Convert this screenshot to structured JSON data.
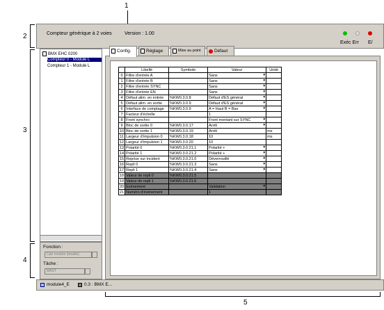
{
  "callouts": {
    "c1": "1",
    "c2": "2",
    "c3": "3",
    "c4": "4",
    "c5": "5"
  },
  "header": {
    "title": "Compteur générique à 2 voies",
    "version": "Version : 1.00",
    "run_err": "Exéc Err",
    "io": "E/",
    "led_colors": {
      "run": "#00c000",
      "err": "#e0e0e0",
      "io": "#e00000"
    }
  },
  "tree": {
    "root": "BMX EHC 0200",
    "items": [
      "Compteur 0 - Module L",
      "Compteur 1 - Module L"
    ]
  },
  "function_label": "Fonction :",
  "function_value": "Cptr module (double)",
  "task_label": "Tâche :",
  "task_value": "MAST",
  "tabs": [
    "Config.",
    "Réglage",
    "Mise au point",
    "Défaut"
  ],
  "table": {
    "headers": [
      "",
      "Libellé",
      "Symbole",
      "Valeur",
      "Unité"
    ],
    "rows": [
      [
        "0",
        "Filtre d'entrée A",
        "",
        "Sans",
        ""
      ],
      [
        "1",
        "Filtre d'entrée B",
        "",
        "Sans",
        ""
      ],
      [
        "2",
        "Filtre d'entrée SYNC",
        "",
        "Sans",
        ""
      ],
      [
        "3",
        "Filtre d'entrée EN",
        "",
        "Sans",
        ""
      ],
      [
        "4",
        "Défaut alim. en entrée",
        "%KW0.3.0.8",
        "Défaut d'ES général",
        ""
      ],
      [
        "5",
        "Défaut alim. en sortie",
        "%KW0.3.0.9",
        "Défaut d'ES général",
        ""
      ],
      [
        "6",
        "Interface de comptage",
        "%KW0.3.0.9",
        "A = Haut B = Bas",
        ""
      ],
      [
        "7",
        "Facteur d'échelle",
        "",
        "1",
        ""
      ],
      [
        "8",
        "Front synchro",
        "",
        "Front montant sur SYNC",
        ""
      ],
      [
        "9",
        "Bloc de sortie 0",
        "%KW0.3.0.17",
        "Arrêt",
        ""
      ],
      [
        "10",
        "Bloc de sortie 1",
        "%KW0.3.0.19",
        "Arrêt",
        "ms"
      ],
      [
        "11",
        "Largeur d'impulsion 0",
        "%KW0.3.0.18",
        "10",
        "ms"
      ],
      [
        "12",
        "Largeur d'impulsion 1",
        "%KW0.3.0.20",
        "10",
        ""
      ],
      [
        "13",
        "Polarité 0",
        "%KW0.3.0.21.1",
        "Polarité +",
        ""
      ],
      [
        "14",
        "Polarité 1",
        "%KW0.3.0.21.2",
        "Polarité +",
        ""
      ],
      [
        "15",
        "Reprise sur incident",
        "%KW0.3.0.21.0",
        "Déverrouillé",
        ""
      ],
      [
        "16",
        "Repli 0",
        "%KW0.3.0.21.3",
        "Sans",
        ""
      ],
      [
        "17",
        "Repli 1",
        "%KW0.3.0.21.4",
        "Sans",
        ""
      ],
      [
        "18",
        "Valeur de repli 0",
        "%KW0.3.0.21.5",
        "",
        ""
      ],
      [
        "19",
        "Valeur de repli 1",
        "%KW0.3.0.21.6",
        "",
        ""
      ],
      [
        "20",
        "Evénement",
        "",
        "Validation",
        ""
      ],
      [
        "21",
        "Numéro d'événement",
        "",
        "1",
        ""
      ]
    ]
  },
  "status_tabs": [
    "module4_E",
    "0.3 : BMX E..."
  ]
}
